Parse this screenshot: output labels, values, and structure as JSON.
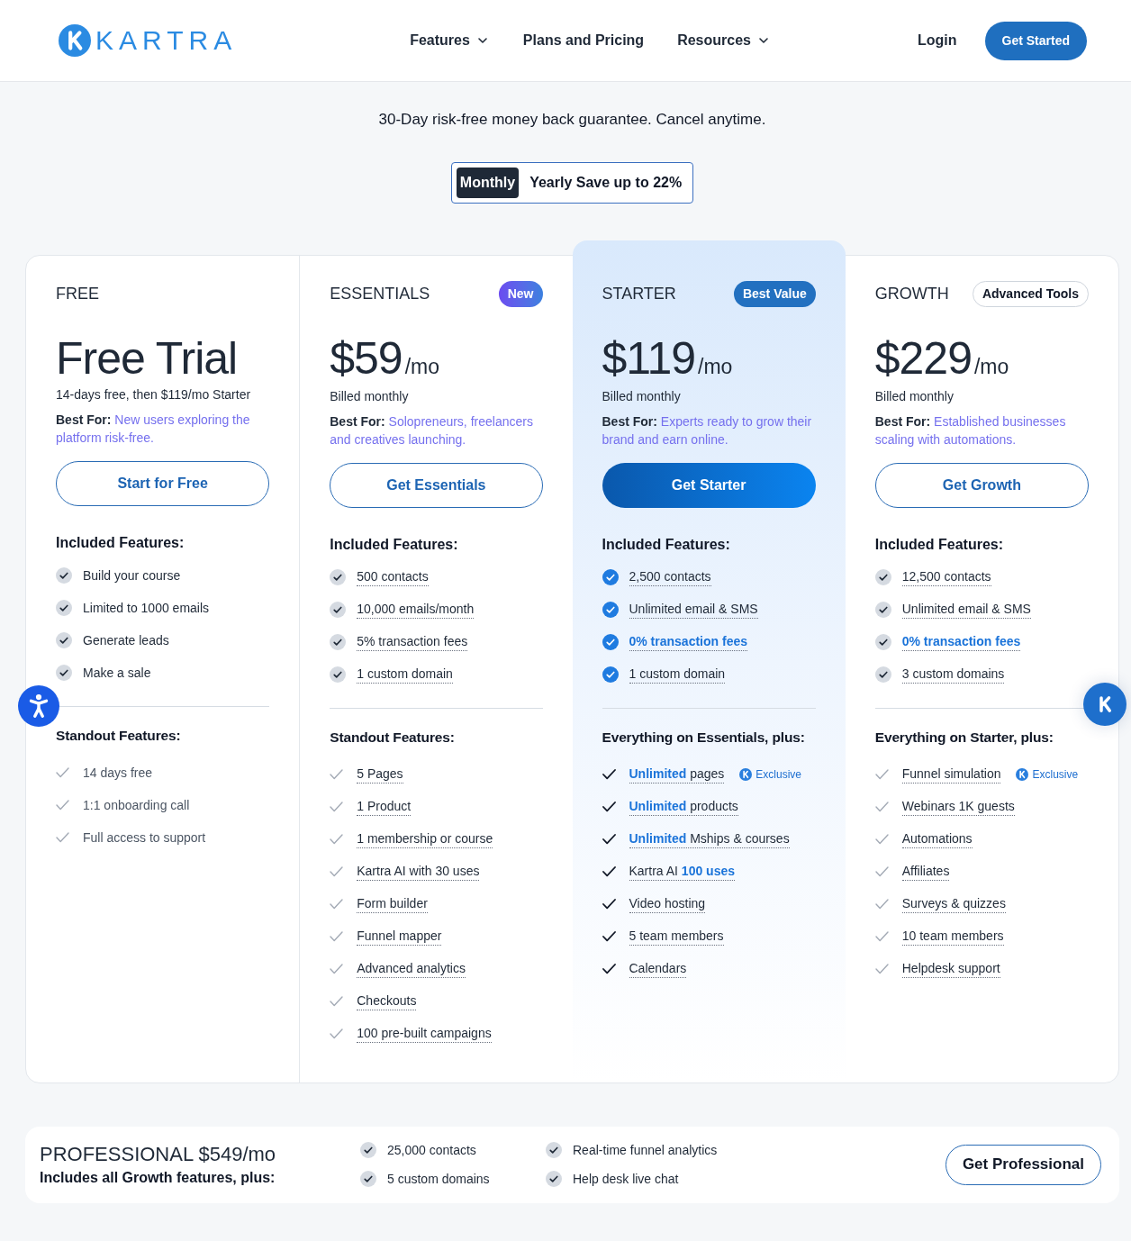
{
  "header": {
    "logo": {
      "text": "KARTRA"
    },
    "nav": [
      {
        "label": "Features",
        "has_menu": true
      },
      {
        "label": "Plans and Pricing",
        "has_menu": false
      },
      {
        "label": "Resources",
        "has_menu": true
      }
    ],
    "login": "Login",
    "cta": "Get Started"
  },
  "hero": {
    "subtitle": "30-Day risk-free money back guarantee. Cancel anytime."
  },
  "billing_toggle": [
    {
      "label": "Monthly",
      "selected": true
    },
    {
      "label": "Yearly Save up to 22%",
      "selected": false
    }
  ],
  "plans": [
    {
      "name": "FREE",
      "featured": false,
      "underlined": false,
      "price": {
        "amount": "Free Trial"
      },
      "note": "14-days free, then $119/mo Starter",
      "best_for": "**Best For:** New users exploring the platform risk-free.",
      "button": "Start for Free",
      "included": {
        "heading": "Included Features:",
        "items": [
          {
            "text": "Build your course",
            "emphasis": false
          },
          {
            "text": "Limited to 1000 emails",
            "emphasis": false
          },
          {
            "text": "Generate leads",
            "emphasis": false
          },
          {
            "text": "Make a sale",
            "emphasis": false
          }
        ]
      },
      "standout": {
        "heading": "Standout Features:",
        "items": [
          {
            "text": "14 days free"
          },
          {
            "text": "1:1 onboarding call"
          },
          {
            "text": "Full access to support"
          }
        ]
      }
    },
    {
      "name": "ESSENTIALS",
      "badge": {
        "text": "New",
        "kind": "gradient"
      },
      "featured": false,
      "underlined": true,
      "price": {
        "amount": "$59",
        "unit": "/mo"
      },
      "note": "Billed monthly",
      "best_for": "**Best For:** Solopreneurs, freelancers and creatives launching.",
      "button": "Get Essentials",
      "included": {
        "heading": "Included Features:",
        "items": [
          {
            "text": "500 contacts",
            "emphasis": false
          },
          {
            "text": "10,000 emails/month",
            "emphasis": false
          },
          {
            "text": "5% transaction fees",
            "emphasis": false
          },
          {
            "text": "1 custom domain",
            "emphasis": false
          }
        ]
      },
      "standout": {
        "heading": "Standout Features:",
        "items": [
          {
            "text": "5 Pages"
          },
          {
            "text": "1 Product"
          },
          {
            "text": "1 membership or course"
          },
          {
            "text": "Kartra AI with 30 uses"
          },
          {
            "text": "Form builder"
          },
          {
            "text": "Funnel mapper"
          },
          {
            "text": "Advanced analytics"
          },
          {
            "text": "Checkouts"
          },
          {
            "text": "100 pre-built campaigns"
          }
        ]
      }
    },
    {
      "name": "STARTER",
      "badge": {
        "text": "Best Value",
        "kind": "solid"
      },
      "featured": true,
      "underlined": true,
      "price": {
        "amount": "$119",
        "unit": "/mo"
      },
      "note": "Billed monthly",
      "best_for": "**Best For:** Experts ready to grow their brand and earn online.",
      "button": "Get Starter",
      "included": {
        "heading": "Included Features:",
        "items": [
          {
            "text": "2,500 contacts",
            "emphasis": false
          },
          {
            "text": "Unlimited email & SMS",
            "emphasis": false
          },
          {
            "text": "0% transaction fees",
            "emphasis": true
          },
          {
            "text": "1 custom domain",
            "emphasis": false
          }
        ]
      },
      "standout": {
        "heading": "Everything on Essentials, plus:",
        "items": [
          {
            "text": "**Unlimited** pages",
            "tag": "Exclusive"
          },
          {
            "text": "**Unlimited** products"
          },
          {
            "text": "**Unlimited** Mships & courses"
          },
          {
            "text": "Kartra AI **100 uses**"
          },
          {
            "text": "Video hosting"
          },
          {
            "text": "5 team members"
          },
          {
            "text": "Calendars"
          }
        ]
      }
    },
    {
      "name": "GROWTH",
      "badge": {
        "text": "Advanced Tools",
        "kind": "outline"
      },
      "featured": false,
      "underlined": true,
      "price": {
        "amount": "$229",
        "unit": "/mo"
      },
      "note": "Billed monthly",
      "best_for": "**Best For:** Established businesses scaling with automations.",
      "button": "Get Growth",
      "included": {
        "heading": "Included Features:",
        "items": [
          {
            "text": "12,500 contacts",
            "emphasis": false
          },
          {
            "text": "Unlimited email & SMS",
            "emphasis": false
          },
          {
            "text": "0% transaction fees",
            "emphasis": true
          },
          {
            "text": "3 custom domains",
            "emphasis": false
          }
        ]
      },
      "standout": {
        "heading": "Everything on Starter, plus:",
        "items": [
          {
            "text": "Funnel simulation",
            "tag": "Exclusive"
          },
          {
            "text": "Webinars 1K guests"
          },
          {
            "text": "Automations"
          },
          {
            "text": "Affiliates"
          },
          {
            "text": "Surveys & quizzes"
          },
          {
            "text": "10 team members"
          },
          {
            "text": "Helpdesk support"
          }
        ]
      }
    }
  ],
  "professional": {
    "title": "PROFESSIONAL $549/mo",
    "subtitle": "Includes all Growth features, plus:",
    "features": [
      "25,000 contacts",
      "5 custom domains",
      "Real-time funnel analytics",
      "Help desk live chat"
    ],
    "button": "Get Professional"
  }
}
